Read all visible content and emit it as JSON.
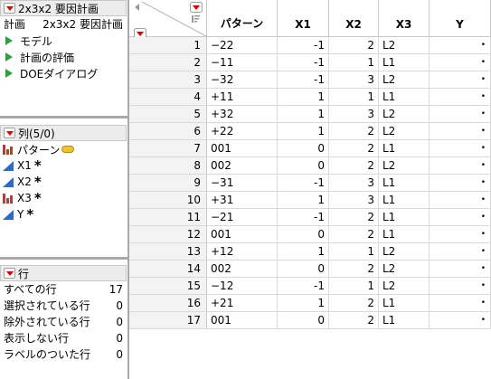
{
  "table_panel": {
    "title": "2x3x2 要因計画",
    "subtitle_left": "計画",
    "subtitle_right": "2x3x2 要因計画",
    "scripts": [
      "モデル",
      "計画の評価",
      "DOEダイアログ"
    ]
  },
  "columns_panel": {
    "title": "列(5/0)",
    "items": [
      {
        "name": "パターン",
        "type": "nominal",
        "badge": "tag-icon"
      },
      {
        "name": "X1",
        "type": "continuous",
        "badge": "*"
      },
      {
        "name": "X2",
        "type": "continuous",
        "badge": "*"
      },
      {
        "name": "X3",
        "type": "nominal",
        "badge": "*"
      },
      {
        "name": "Y",
        "type": "continuous",
        "badge": "*"
      }
    ]
  },
  "rows_panel": {
    "title": "行",
    "items": [
      {
        "label": "すべての行",
        "value": "17"
      },
      {
        "label": "選択されている行",
        "value": "0"
      },
      {
        "label": "除外されている行",
        "value": "0"
      },
      {
        "label": "表示しない行",
        "value": "0"
      },
      {
        "label": "ラベルのついた行",
        "value": "0"
      }
    ]
  },
  "table": {
    "headers": [
      "パターン",
      "X1",
      "X2",
      "X3",
      "Y"
    ],
    "rows": [
      {
        "n": "1",
        "pattern": "−22",
        "x1": "-1",
        "x2": "2",
        "x3": "L2",
        "y": "•"
      },
      {
        "n": "2",
        "pattern": "−11",
        "x1": "-1",
        "x2": "1",
        "x3": "L1",
        "y": "•"
      },
      {
        "n": "3",
        "pattern": "−32",
        "x1": "-1",
        "x2": "3",
        "x3": "L2",
        "y": "•"
      },
      {
        "n": "4",
        "pattern": "+11",
        "x1": "1",
        "x2": "1",
        "x3": "L1",
        "y": "•"
      },
      {
        "n": "5",
        "pattern": "+32",
        "x1": "1",
        "x2": "3",
        "x3": "L2",
        "y": "•"
      },
      {
        "n": "6",
        "pattern": "+22",
        "x1": "1",
        "x2": "2",
        "x3": "L2",
        "y": "•"
      },
      {
        "n": "7",
        "pattern": "001",
        "x1": "0",
        "x2": "2",
        "x3": "L1",
        "y": "•"
      },
      {
        "n": "8",
        "pattern": "002",
        "x1": "0",
        "x2": "2",
        "x3": "L2",
        "y": "•"
      },
      {
        "n": "9",
        "pattern": "−31",
        "x1": "-1",
        "x2": "3",
        "x3": "L1",
        "y": "•"
      },
      {
        "n": "10",
        "pattern": "+31",
        "x1": "1",
        "x2": "3",
        "x3": "L1",
        "y": "•"
      },
      {
        "n": "11",
        "pattern": "−21",
        "x1": "-1",
        "x2": "2",
        "x3": "L1",
        "y": "•"
      },
      {
        "n": "12",
        "pattern": "001",
        "x1": "0",
        "x2": "2",
        "x3": "L1",
        "y": "•"
      },
      {
        "n": "13",
        "pattern": "+12",
        "x1": "1",
        "x2": "1",
        "x3": "L2",
        "y": "•"
      },
      {
        "n": "14",
        "pattern": "002",
        "x1": "0",
        "x2": "2",
        "x3": "L2",
        "y": "•"
      },
      {
        "n": "15",
        "pattern": "−12",
        "x1": "-1",
        "x2": "1",
        "x3": "L2",
        "y": "•"
      },
      {
        "n": "16",
        "pattern": "+21",
        "x1": "1",
        "x2": "2",
        "x3": "L1",
        "y": "•"
      },
      {
        "n": "17",
        "pattern": "001",
        "x1": "0",
        "x2": "2",
        "x3": "L1",
        "y": "•"
      }
    ]
  }
}
